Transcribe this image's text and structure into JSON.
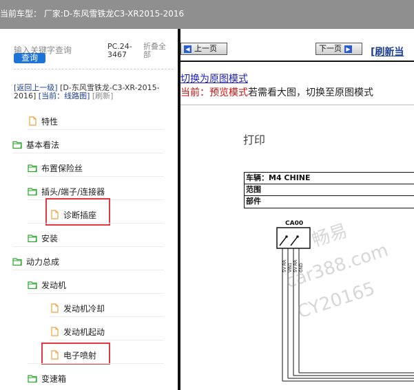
{
  "header": {
    "title": "当前车型：  厂家:D-东风雪铁龙C3-XR2015-2016"
  },
  "sidebar": {
    "search_label": "输入关键字查询",
    "search_button": "查询",
    "pc_code": "PC.24-3467",
    "collapse_all": "折叠全部",
    "back_link": "[返回上一级]",
    "breadcrumb_vehicle": "[D-东风雪铁龙-C3-XR-2015-2016]",
    "current_label": "[当前：线路图]",
    "refresh": "[刷新]",
    "tree": [
      {
        "label": "特性",
        "type": "file"
      },
      {
        "label": "基本看法",
        "type": "folder"
      },
      {
        "label": "布置保险丝",
        "type": "folder"
      },
      {
        "label": "插头/端子/连接器",
        "type": "folder"
      },
      {
        "label": "诊断插座",
        "type": "file"
      },
      {
        "label": "安装",
        "type": "folder"
      },
      {
        "label": "动力总成",
        "type": "folder"
      },
      {
        "label": "发动机",
        "type": "folder"
      },
      {
        "label": "发动机冷却",
        "type": "file"
      },
      {
        "label": "发动机起动",
        "type": "file"
      },
      {
        "label": "电子喷射",
        "type": "file"
      },
      {
        "label": "变速箱",
        "type": "folder"
      }
    ]
  },
  "viewer": {
    "prev_page": "上一页",
    "next_page": "下一页",
    "refresh_link": "[刷新当",
    "switch_link": "切换为原图模式",
    "mode_current": "当前：预览模式",
    "mode_hint": "若需看大图，切换至原图模式"
  },
  "document": {
    "print_label": "打印",
    "rows": [
      {
        "label": "车辆：M4 CHINE"
      },
      {
        "label": "范围"
      },
      {
        "label": "部件"
      }
    ],
    "connector_label": "CA00",
    "pin_labels": [
      "5V RR",
      "VIN1",
      "5V RR",
      "GND"
    ],
    "watermark": [
      "畅易",
      "car388.com",
      "CY20165"
    ]
  },
  "colors": {
    "header_bg": "#8f8f8f",
    "accent_blue": "#1e73d6",
    "highlight_red": "#e0383e",
    "folder_green": "#2aa52a",
    "file_orange": "#f0a040"
  }
}
